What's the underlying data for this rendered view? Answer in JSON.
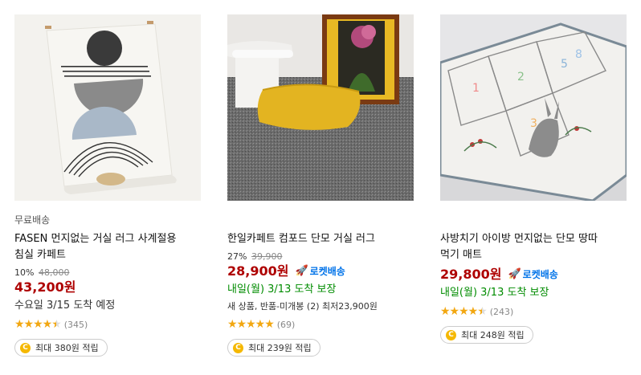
{
  "products": [
    {
      "free_shipping": "무료배송",
      "title_line1": "FASEN 먼지없는 거실 러그 사계절용",
      "title_line2": "침실 카페트",
      "discount": "10%",
      "original_price": "48,000",
      "sale_price": "43,200원",
      "delivery": "수요일 3/15 도착 예정",
      "rating": 4.5,
      "review_count": "(345)",
      "points": "최대 380원 적립",
      "image_icon": "abstract-rug-image"
    },
    {
      "title_line1": "한일카페트 컴포드 단모 거실 러그",
      "discount": "27%",
      "original_price": "39,900",
      "sale_price": "28,900원",
      "rocket_label": "로켓배송",
      "delivery": "내일(월) 3/13 도착 보장",
      "other_offers": "새 상품, 반품-미개봉 (2) 최저23,900원",
      "rating": 5,
      "review_count": "(69)",
      "points": "최대 239원 적립",
      "image_icon": "gray-carpet-image"
    },
    {
      "title_line1": "사방치기 아이방 먼지없는 단모 땅따",
      "title_line2": "먹기 매트",
      "sale_price": "29,800원",
      "rocket_label": "로켓배송",
      "delivery": "내일(월) 3/13 도착 보장",
      "rating": 4.5,
      "review_count": "(243)",
      "points": "최대 248원 적립",
      "image_icon": "hopscotch-mat-image"
    }
  ],
  "colors": {
    "sale_price": "#ae0000",
    "rocket": "#0073e9",
    "delivery_green": "#008c00",
    "star": "#f2a711",
    "coin": "#f5b800"
  }
}
